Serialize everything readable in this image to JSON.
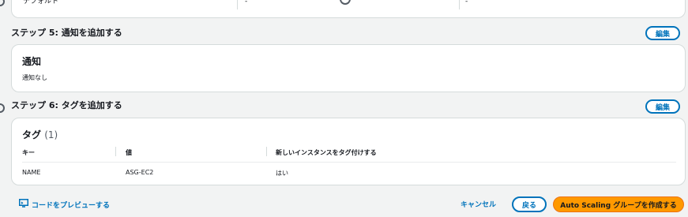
{
  "top_row": {
    "cell1": "デフォルト",
    "cell2": "-",
    "cell3": "-"
  },
  "step5": {
    "title": "ステップ 5: 通知を追加する",
    "edit_label": "編集",
    "heading": "通知",
    "body": "通知なし"
  },
  "step6": {
    "title": "ステップ 6: タグを追加する",
    "edit_label": "編集",
    "heading": "タグ",
    "count": "(1)",
    "columns": [
      "キー",
      "値",
      "新しいインスタンスをタグ付けする"
    ],
    "rows": [
      {
        "key": "NAME",
        "value": "ASG-EC2",
        "tag_new": "はい"
      }
    ]
  },
  "footer": {
    "preview_code": "コードをプレビューする",
    "cancel": "キャンセル",
    "back": "戻る",
    "create": "Auto Scaling グループを作成する"
  },
  "colors": {
    "accent": "#0073bb",
    "primary": "#ff9900"
  }
}
